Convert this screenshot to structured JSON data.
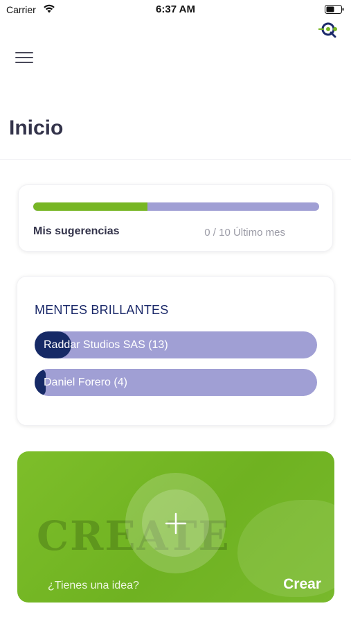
{
  "status_bar": {
    "carrier": "Carrier",
    "time": "6:37 AM"
  },
  "header": {
    "title": "Inicio"
  },
  "suggestions": {
    "label": "Mis sugerencias",
    "count": "0 / 10 Último mes",
    "progress": 0.4,
    "fill_color": "#77b624",
    "track_color": "#a09fd4"
  },
  "mentes": {
    "title": "MENTES BRILLANTES",
    "items": [
      {
        "label": "Raddar Studios SAS (13)",
        "level": 0.13
      },
      {
        "label": "Daniel Forero (4)",
        "level": 0.04
      }
    ],
    "fill_color": "#162a66"
  },
  "create": {
    "background_text": "CREATE",
    "prompt": "¿Tienes una idea?",
    "button_label": "Crear",
    "accent": "#77b624"
  },
  "icons": [
    "wifi-icon",
    "battery-icon",
    "app-logo-icon",
    "menu-icon",
    "plus-icon"
  ]
}
